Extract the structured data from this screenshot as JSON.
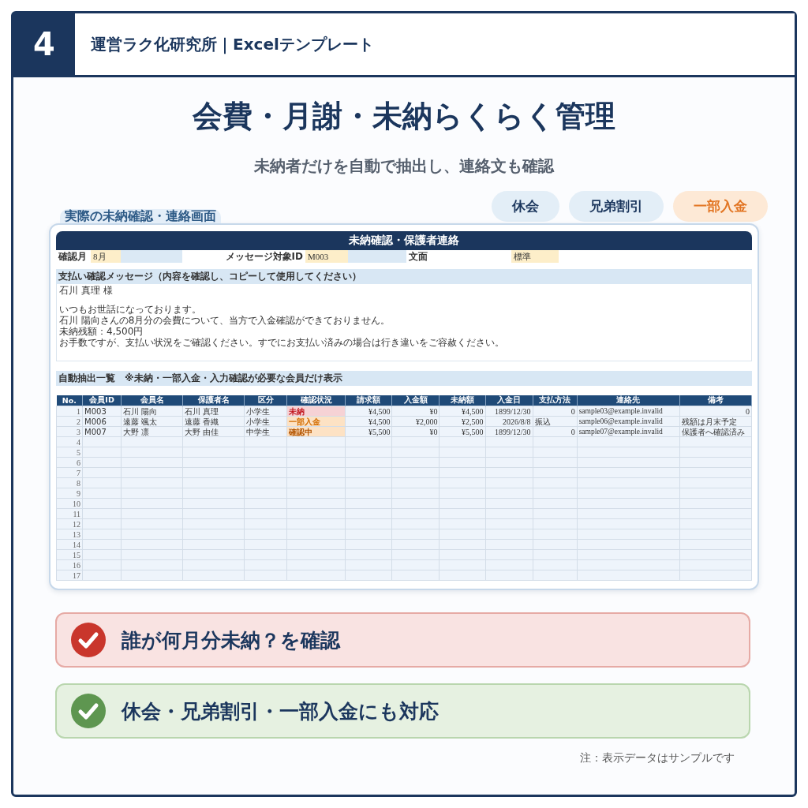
{
  "badge": "4",
  "brand": "運営ラク化研究所｜Excelテンプレート",
  "title": "会費・月謝・未納らくらく管理",
  "subtitle": "未納者だけを自動で抽出し、連絡文も確認",
  "tags": [
    {
      "label": "休会",
      "kind": "plain"
    },
    {
      "label": "兄弟割引",
      "kind": "plain"
    },
    {
      "label": "一部入金",
      "kind": "accent"
    }
  ],
  "screen": {
    "label": "実際の未納確認・連絡画面",
    "sheet_title": "未納確認・保護者連絡",
    "fields": [
      {
        "label": "確認月",
        "value": "8月"
      },
      {
        "label": "メッセージ対象ID",
        "value": "M003"
      },
      {
        "label": "文面",
        "value": "標準"
      }
    ],
    "message": {
      "heading": "支払い確認メッセージ（内容を確認し、コピーして使用してください）",
      "paragraphs": [
        [
          "石川 真理 様"
        ],
        [
          "いつもお世話になっております。",
          "石川 陽向さんの8月分の会費について、当方で入金確認ができておりません。",
          "未納残額：4,500円",
          "お手数ですが、支払い状況をご確認ください。すでにお支払い済みの場合は行き違いをご容赦ください。"
        ]
      ]
    },
    "list": {
      "heading": "自動抽出一覧",
      "note": "※未納・一部入金・入力確認が必要な会員だけ表示"
    },
    "table": {
      "columns": [
        "No.",
        "会員ID",
        "会員名",
        "保護者名",
        "区分",
        "確認状況",
        "請求額",
        "入金額",
        "未納額",
        "入金日",
        "支払方法",
        "連絡先",
        "備考"
      ],
      "rows": [
        {
          "cells": [
            "1",
            "M003",
            "石川 陽向",
            "石川 真理",
            "小学生",
            "未納",
            "¥4,500",
            "¥0",
            "¥4,500",
            "1899/12/30",
            "0",
            "sample03@example.invalid",
            "0"
          ],
          "kind": "unpaid"
        },
        {
          "cells": [
            "2",
            "M006",
            "遠藤 颯太",
            "遠藤 香織",
            "小学生",
            "一部入金",
            "¥4,500",
            "¥2,000",
            "¥2,500",
            "2026/8/8",
            "振込",
            "sample06@example.invalid",
            "残額は月末予定"
          ],
          "kind": "partial"
        },
        {
          "cells": [
            "3",
            "M007",
            "大野 凛",
            "大野 由佳",
            "中学生",
            "確認中",
            "¥5,500",
            "¥0",
            "¥5,500",
            "1899/12/30",
            "0",
            "sample07@example.invalid",
            "保護者へ確認済み"
          ],
          "kind": "checking"
        },
        {
          "cells": [
            "4"
          ]
        },
        {
          "cells": [
            "5"
          ]
        },
        {
          "cells": [
            "6"
          ]
        },
        {
          "cells": [
            "7"
          ]
        },
        {
          "cells": [
            "8"
          ]
        },
        {
          "cells": [
            "9"
          ]
        },
        {
          "cells": [
            "10"
          ]
        },
        {
          "cells": [
            "11"
          ]
        },
        {
          "cells": [
            "12"
          ]
        },
        {
          "cells": [
            "13"
          ]
        },
        {
          "cells": [
            "14"
          ]
        },
        {
          "cells": [
            "15"
          ]
        },
        {
          "cells": [
            "16"
          ]
        },
        {
          "cells": [
            "17"
          ]
        }
      ]
    }
  },
  "callouts": [
    {
      "text": "誰が何月分未納？を確認",
      "kind": "alert"
    },
    {
      "text": "休会・兄弟割引・一部入金にも対応",
      "kind": "ok"
    }
  ],
  "footnote": "注：表示データはサンプルです"
}
